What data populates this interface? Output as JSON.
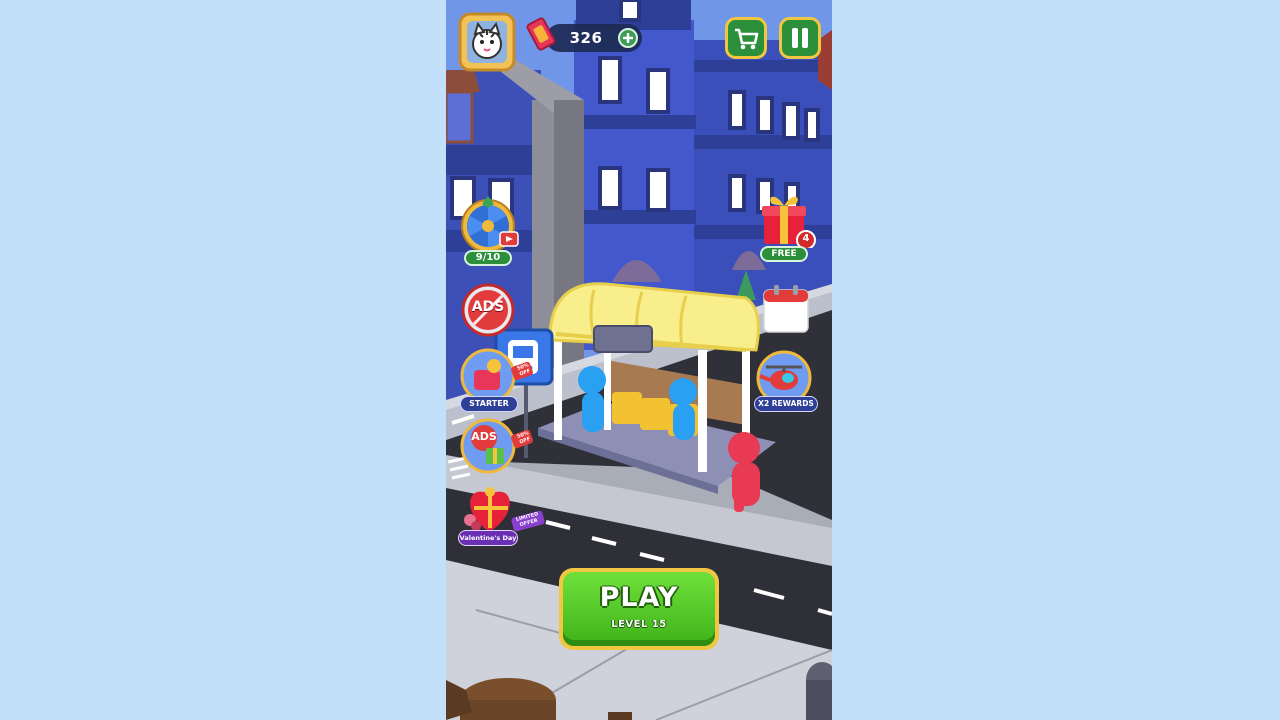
{
  "hud": {
    "tickets": "326",
    "icons": {
      "avatar": "tiger-avatar-icon",
      "ticket": "ticket-icon",
      "add": "plus-icon",
      "shop": "shopping-cart-icon",
      "pause": "pause-icon"
    }
  },
  "left_offers": {
    "spin_wheel": {
      "progress": "9/10",
      "icon": "spin-wheel-icon"
    },
    "no_ads": {
      "label": "ADS",
      "icon": "no-ads-icon"
    },
    "starter": {
      "label": "STARTER",
      "badge": "50% OFF",
      "icon": "starter-pack-icon"
    },
    "ads_bundle": {
      "label": "ADS",
      "badge": "50% OFF",
      "icon": "ads-bundle-icon"
    },
    "valentines": {
      "label": "Valentine's Day",
      "badge": "LIMITED OFFER",
      "icon": "valentine-gift-icon"
    }
  },
  "right_offers": {
    "free_gift": {
      "label": "FREE",
      "count": "4",
      "icon": "gift-box-icon"
    },
    "calendar": {
      "icon": "calendar-icon"
    },
    "x2_rewards": {
      "label": "X2 REWARDS",
      "icon": "helicopter-icon"
    }
  },
  "play": {
    "title": "PLAY",
    "level": "LEVEL 15"
  },
  "colors": {
    "page_bg": "#c2e0fa",
    "play_green": "#5ccb2e",
    "play_border": "#f1c640",
    "hud_green": "#2c8f3a",
    "building_blue": "#3f55c4",
    "sky": "#6f96e8"
  }
}
